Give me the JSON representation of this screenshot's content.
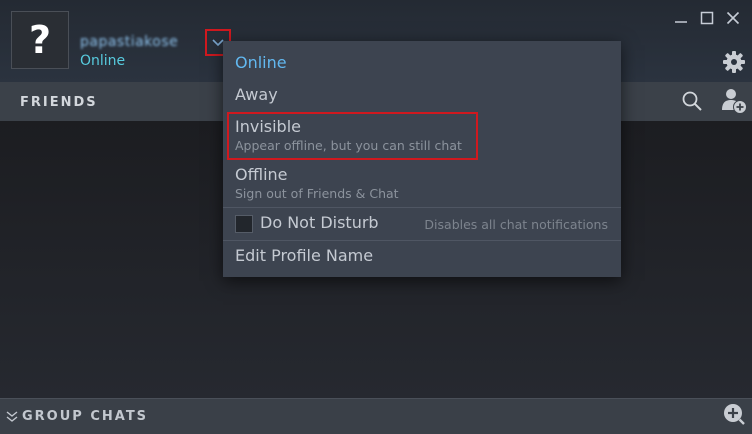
{
  "header": {
    "avatar_glyph": "?",
    "username": "papastiakose",
    "status": "Online"
  },
  "icons": {
    "dropdown": "chevron-down-icon",
    "minimize": "minimize-icon",
    "maximize": "maximize-icon",
    "close": "close-icon",
    "settings": "gear-icon",
    "search": "search-icon",
    "add_friend": "add-friend-icon",
    "group_collapse": "double-chevron-down-icon",
    "group_add": "plus-circle-icon"
  },
  "friends_bar": {
    "label": "FRIENDS"
  },
  "group_bar": {
    "label": "GROUP CHATS"
  },
  "menu": {
    "online": "Online",
    "away": "Away",
    "invisible": "Invisible",
    "invisible_sub": "Appear offline, but you can still chat",
    "offline": "Offline",
    "offline_sub": "Sign out of Friends & Chat",
    "dnd": "Do Not Disturb",
    "dnd_desc": "Disables all chat notifications",
    "edit_profile": "Edit Profile Name"
  },
  "colors": {
    "accent_online": "#62b8f0",
    "status_green_blue": "#57cbde",
    "highlight_red": "#d0191f",
    "menu_bg": "#3d4450"
  }
}
